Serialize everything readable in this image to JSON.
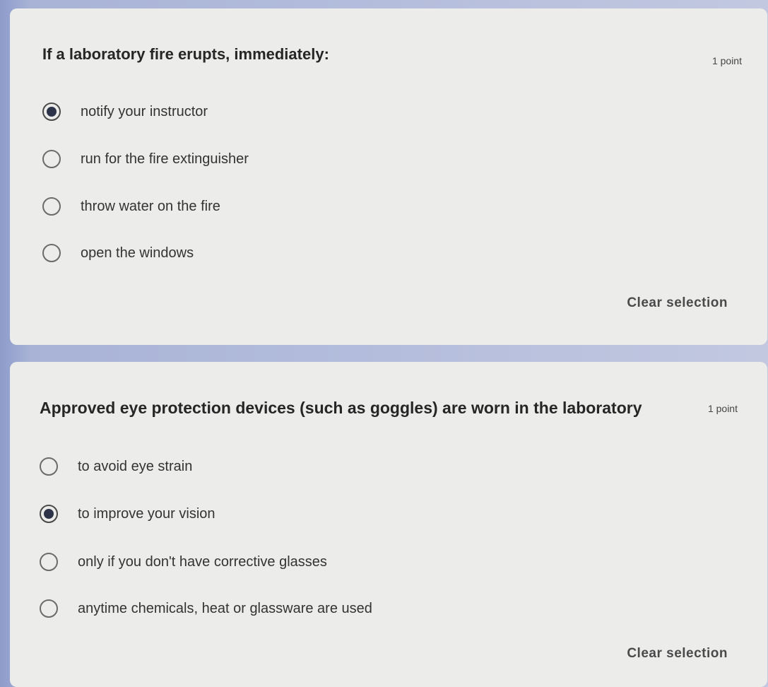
{
  "questions": [
    {
      "title": "If a laboratory fire erupts, immediately:",
      "points": "1 point",
      "options": [
        {
          "label": "notify your instructor",
          "selected": true
        },
        {
          "label": "run for the fire extinguisher",
          "selected": false
        },
        {
          "label": "throw water on the fire",
          "selected": false
        },
        {
          "label": "open the windows",
          "selected": false
        }
      ],
      "clear_label": "Clear selection"
    },
    {
      "title": "Approved eye protection devices (such as goggles) are worn in the laboratory",
      "points": "1 point",
      "options": [
        {
          "label": "to avoid eye strain",
          "selected": false
        },
        {
          "label": "to improve your vision",
          "selected": true
        },
        {
          "label": "only if you don't have corrective glasses",
          "selected": false
        },
        {
          "label": "anytime chemicals, heat or glassware are used",
          "selected": false
        }
      ],
      "clear_label": "Clear selection"
    }
  ],
  "colors": {
    "card_background": "#ececeb",
    "selected_dot": "#2d3348"
  }
}
